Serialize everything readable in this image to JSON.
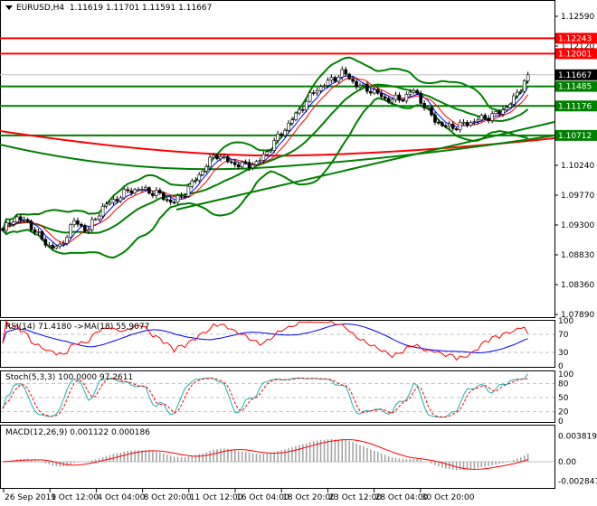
{
  "header": {
    "symbol": "EURUSD,H4",
    "open": "1.11619",
    "high": "1.11701",
    "low": "1.11591",
    "close": "1.11667"
  },
  "price_axis": [
    "1.12590",
    "1.12120",
    "1.10240",
    "1.09770",
    "1.09300",
    "1.08830",
    "1.08360",
    "1.07890"
  ],
  "price_levels": [
    {
      "value": "1.12243",
      "color": "#ff0000"
    },
    {
      "value": "1.12001",
      "color": "#ff0000"
    },
    {
      "value": "1.11667",
      "color": "#000000",
      "current": true
    },
    {
      "value": "1.11485",
      "color": "#008000"
    },
    {
      "value": "1.11176",
      "color": "#008000"
    },
    {
      "value": "1.10712",
      "color": "#008000"
    }
  ],
  "time_axis": [
    "26 Sep 2019",
    "1 Oct 12:00",
    "4 Oct 04:00",
    "8 Oct 20:00",
    "11 Oct 12:00",
    "16 Oct 04:00",
    "18 Oct 20:00",
    "23 Oct 12:00",
    "28 Oct 04:00",
    "30 Oct 20:00"
  ],
  "rsi": {
    "label": "RSI(14) 71.4180  ->MA(18) 55.9077",
    "axis": [
      "100",
      "70",
      "30",
      "0"
    ]
  },
  "stoch": {
    "label": "Stoch(5,3,3) 100.0000 97.2611",
    "axis": [
      "100",
      "80",
      "50",
      "20",
      "0"
    ]
  },
  "macd": {
    "label": "MACD(12,26,9) 0.001122 0.000186",
    "axis": [
      "0.003819",
      "0.00",
      "-0.002847"
    ]
  },
  "chart_data": {
    "type": "candlestick",
    "symbol": "EURUSD",
    "timeframe": "H4",
    "ylim": [
      1.0789,
      1.1259
    ],
    "close_path_approx": [
      1.09214,
      1.09428,
      1.09286,
      1.09001,
      1.0893,
      1.09357,
      1.09214,
      1.0957,
      1.09713,
      1.09855,
      1.09855,
      1.09784,
      1.09642,
      1.09855,
      1.1014,
      1.10425,
      1.10283,
      1.1024,
      1.10283,
      1.10568,
      1.10852,
      1.11137,
      1.11422,
      1.11565,
      1.11707,
      1.11493,
      1.11422,
      1.1128,
      1.1128,
      1.11422,
      1.11066,
      1.10852,
      1.10852,
      1.10924,
      1.10995,
      1.11066,
      1.1128,
      1.11667
    ],
    "colors": {
      "bollinger": "#008000",
      "ma_fast": "#0000ff",
      "ma_slow": "#ff0000",
      "long_ma": "#ff0000",
      "support_resistance": "#008000"
    }
  }
}
